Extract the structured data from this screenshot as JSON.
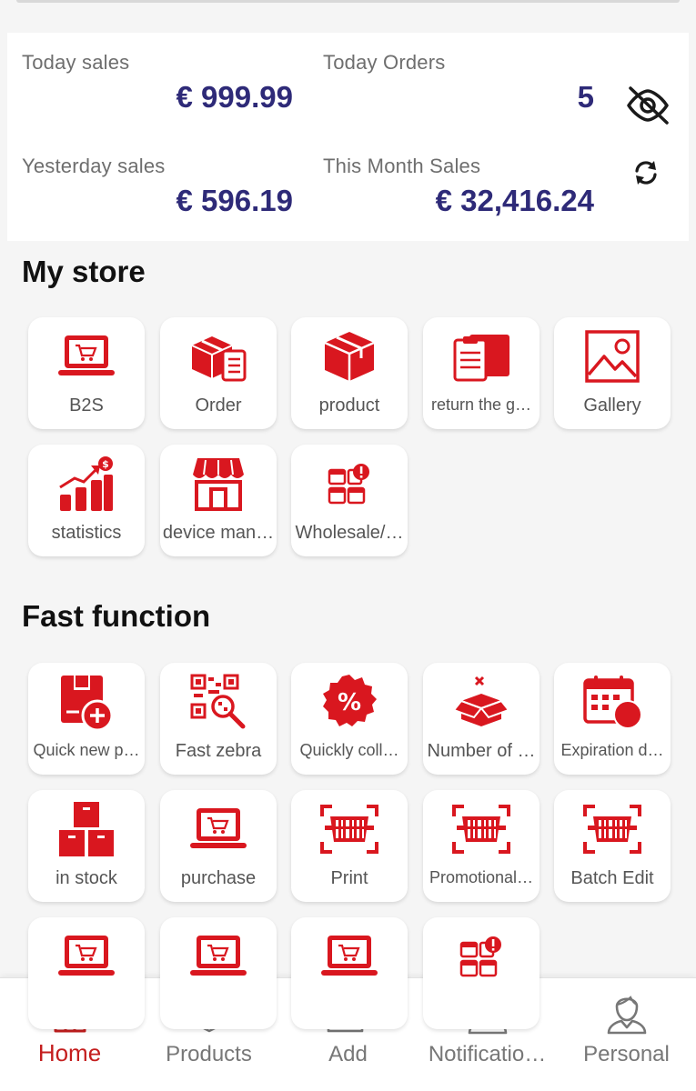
{
  "stats": {
    "today_sales": {
      "label": "Today sales",
      "value": "€ 999.99"
    },
    "today_orders": {
      "label": "Today Orders",
      "value": "5"
    },
    "yesterday_sales": {
      "label": "Yesterday sales",
      "value": "€ 596.19"
    },
    "month_sales": {
      "label": "This Month Sales",
      "value": "€ 32,416.24"
    }
  },
  "my_store": {
    "title": "My store",
    "items": [
      {
        "label": "B2S",
        "icon": "laptop-cart-icon"
      },
      {
        "label": "Order",
        "icon": "order-boxes-icon"
      },
      {
        "label": "product",
        "icon": "product-box-icon"
      },
      {
        "label": "return the g…",
        "icon": "return-clipboard-icon"
      },
      {
        "label": "Gallery",
        "icon": "gallery-image-icon"
      },
      {
        "label": "statistics",
        "icon": "statistics-chart-icon"
      },
      {
        "label": "device man…",
        "icon": "store-front-icon"
      },
      {
        "label": "Wholesale/…",
        "icon": "wholesale-boxes-icon"
      }
    ]
  },
  "fast_function": {
    "title": "Fast function",
    "items": [
      {
        "label": "Quick new p…",
        "icon": "quick-new-product-icon"
      },
      {
        "label": "Fast zebra",
        "icon": "qr-scan-icon"
      },
      {
        "label": "Quickly coll…",
        "icon": "percent-badge-icon"
      },
      {
        "label": "Number of …",
        "icon": "open-box-icon"
      },
      {
        "label": "Expiration d…",
        "icon": "calendar-icon"
      },
      {
        "label": "in stock",
        "icon": "stacked-boxes-icon"
      },
      {
        "label": "purchase",
        "icon": "laptop-cart-icon"
      },
      {
        "label": "Print",
        "icon": "barcode-scan-icon"
      },
      {
        "label": "Promotional…",
        "icon": "barcode-scan-icon"
      },
      {
        "label": "Batch Edit",
        "icon": "barcode-scan-icon"
      },
      {
        "label": "",
        "icon": "laptop-cart-icon"
      },
      {
        "label": "",
        "icon": "laptop-cart-icon"
      },
      {
        "label": "",
        "icon": "laptop-cart-icon"
      },
      {
        "label": "",
        "icon": "wholesale-boxes-icon"
      }
    ]
  },
  "bottom_nav": [
    {
      "label": "Home",
      "icon": "home-icon",
      "active": true
    },
    {
      "label": "Products",
      "icon": "layers-icon",
      "active": false
    },
    {
      "label": "Add",
      "icon": "add-folder-icon",
      "active": false
    },
    {
      "label": "Notificatio…",
      "icon": "user-icon",
      "active": false
    },
    {
      "label": "Personal",
      "icon": "user-icon",
      "active": false
    }
  ],
  "colors": {
    "accent": "#d9171f",
    "value_text": "#2e2a78",
    "active_nav": "#c41e1e"
  }
}
